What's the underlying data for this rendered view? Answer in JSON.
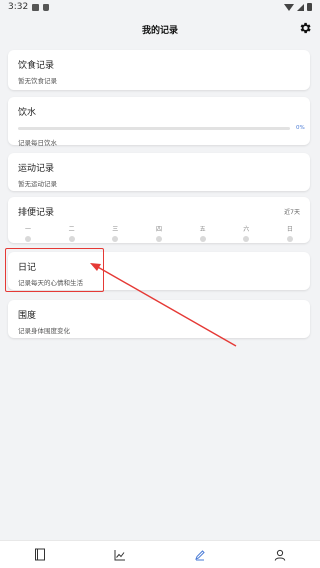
{
  "status_bar": {
    "time": "3:32"
  },
  "header": {
    "title": "我的记录"
  },
  "cards": {
    "diet": {
      "title": "饮食记录",
      "subtitle": "暂无饮食记录"
    },
    "water": {
      "title": "饮水",
      "progress_percent": 0,
      "progress_label": "0%",
      "subtitle": "记录每日饮水"
    },
    "sport": {
      "title": "运动记录",
      "subtitle": "暂无运动记录"
    },
    "bowel": {
      "title": "排便记录",
      "range": "近7天",
      "days": [
        "一",
        "二",
        "三",
        "四",
        "五",
        "六",
        "日"
      ]
    },
    "diary": {
      "title": "日记",
      "subtitle": "记录每天的心情和生活"
    },
    "girth": {
      "title": "围度",
      "subtitle": "记录身体围度变化"
    }
  },
  "colors": {
    "accent": "#4a7bd6",
    "highlight": "#e53935",
    "background": "#f2f3f5"
  },
  "bottom_nav": {
    "items": [
      {
        "icon": "book-icon"
      },
      {
        "icon": "chart-icon"
      },
      {
        "icon": "pen-icon",
        "active": true
      },
      {
        "icon": "person-icon"
      }
    ]
  }
}
